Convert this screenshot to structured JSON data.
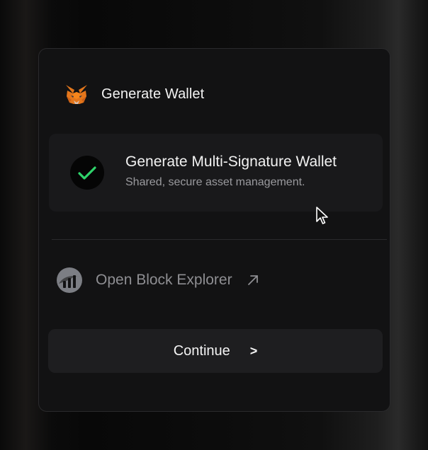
{
  "dialog": {
    "title": "Generate Wallet",
    "logo_icon": "metamask-fox-icon"
  },
  "option": {
    "title": "Generate Multi-Signature Wallet",
    "subtitle": "Shared, secure asset management.",
    "selected": true,
    "check_icon": "checkmark-icon",
    "check_color": "#2fd36b"
  },
  "explorer_link": {
    "label": "Open Block Explorer",
    "icon": "block-explorer-icon",
    "external_icon": "arrow-up-right-icon"
  },
  "continue_button": {
    "label": "Continue",
    "chevron": ">"
  }
}
